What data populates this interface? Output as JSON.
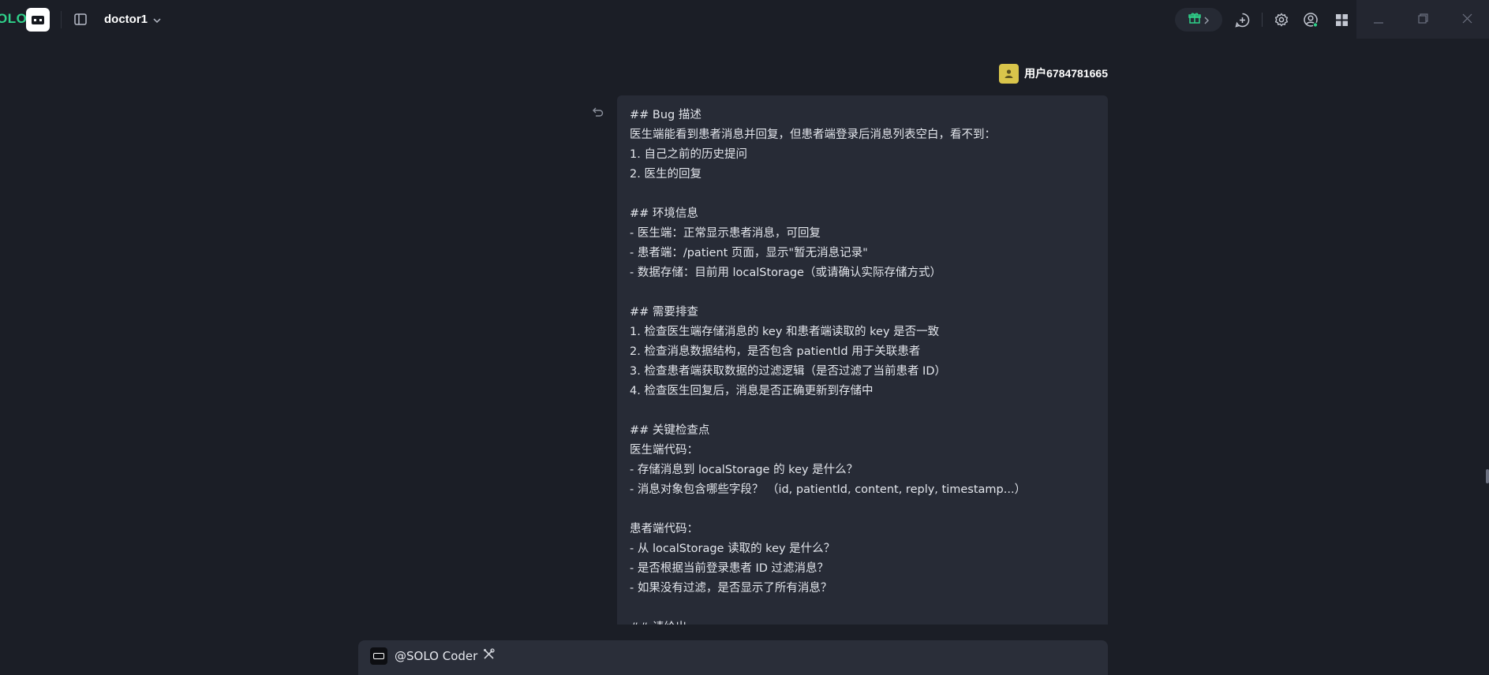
{
  "app": {
    "logo_text": "OLO",
    "project_name": "doctor1"
  },
  "user": {
    "name": "用户6784781665"
  },
  "message": {
    "lines": [
      "## Bug 描述",
      "医生端能看到患者消息并回复，但患者端登录后消息列表空白，看不到：",
      "1. 自己之前的历史提问",
      "2. 医生的回复",
      "",
      "## 环境信息",
      "- 医生端：正常显示患者消息，可回复",
      "- 患者端：/patient 页面，显示\"暂无消息记录\"",
      "- 数据存储：目前用 localStorage（或请确认实际存储方式）",
      "",
      "## 需要排查",
      "1. 检查医生端存储消息的 key 和患者端读取的 key 是否一致",
      "2. 检查消息数据结构，是否包含 patientId 用于关联患者",
      "3. 检查患者端获取数据的过滤逻辑（是否过滤了当前患者 ID）",
      "4. 检查医生回复后，消息是否正确更新到存储中",
      "",
      "## 关键检查点",
      "医生端代码：",
      "- 存储消息到 localStorage 的 key 是什么？",
      "- 消息对象包含哪些字段？ （id, patientId, content, reply, timestamp...）",
      "",
      "患者端代码：",
      "- 从 localStorage 读取的 key 是什么？",
      "- 是否根据当前登录患者 ID 过滤消息？",
      "- 如果没有过滤，是否显示了所有消息？",
      "",
      "## 请给出"
    ]
  },
  "composer": {
    "agent_label": "@SOLO Coder"
  },
  "icons": {
    "logo": "solo-logo-icon",
    "sidebar_toggle": "sidebar-toggle-icon",
    "dropdown": "chevron-down-icon",
    "gift": "gift-icon",
    "new_chat": "new-chat-icon",
    "settings": "gear-icon",
    "account": "account-icon",
    "apps": "apps-grid-icon",
    "undo": "undo-icon",
    "tools": "tools-icon"
  },
  "colors": {
    "background": "#1b1e26",
    "bubble": "#272b36",
    "brand_green": "#2fd18a",
    "avatar": "#d9c54b"
  }
}
